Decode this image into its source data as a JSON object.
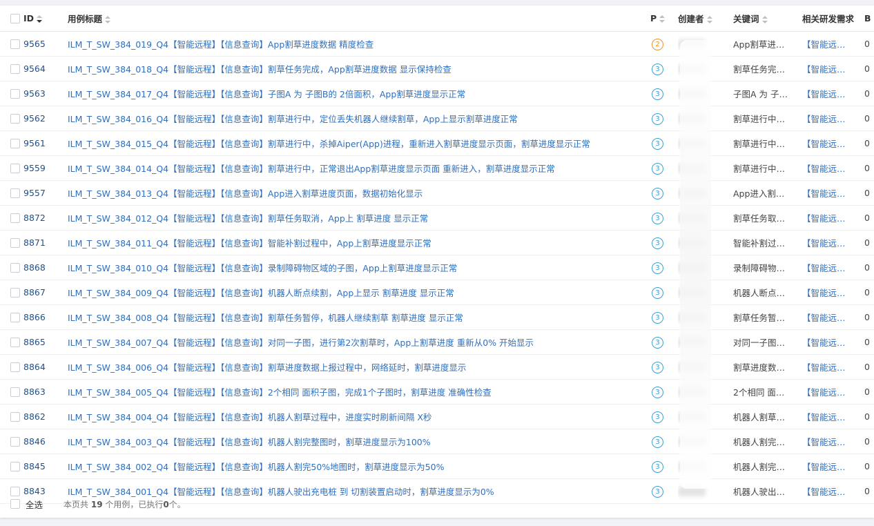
{
  "columns": {
    "id": "ID",
    "title": "用例标题",
    "priority": "P",
    "creator": "创建者",
    "keywords": "关键词",
    "requirement": "相关研发需求",
    "b": "B"
  },
  "rows": [
    {
      "id": "9565",
      "title": "ILM_T_SW_384_019_Q4【智能远程】【信息查询】App割草进度数据 精度检查",
      "priority": "2",
      "keywords": "App割草进…",
      "requirement": "【智能远…",
      "b": "0"
    },
    {
      "id": "9564",
      "title": "ILM_T_SW_384_018_Q4【智能远程】【信息查询】割草任务完成，App割草进度数据 显示保持检查",
      "priority": "3",
      "keywords": "割草任务完…",
      "requirement": "【智能远…",
      "b": "0"
    },
    {
      "id": "9563",
      "title": "ILM_T_SW_384_017_Q4【智能远程】【信息查询】子图A 为 子图B的 2倍面积，App割草进度显示正常",
      "priority": "3",
      "keywords": "子图A 为 子…",
      "requirement": "【智能远…",
      "b": "0"
    },
    {
      "id": "9562",
      "title": "ILM_T_SW_384_016_Q4【智能远程】【信息查询】割草进行中，定位丢失机器人继续割草，App上显示割草进度正常",
      "priority": "3",
      "keywords": "割草进行中…",
      "requirement": "【智能远…",
      "b": "0"
    },
    {
      "id": "9561",
      "title": "ILM_T_SW_384_015_Q4【智能远程】【信息查询】割草进行中，杀掉Aiper(App)进程，重新进入割草进度显示页面，割草进度显示正常",
      "priority": "3",
      "keywords": "割草进行中…",
      "requirement": "【智能远…",
      "b": "0"
    },
    {
      "id": "9559",
      "title": "ILM_T_SW_384_014_Q4【智能远程】【信息查询】割草进行中，正常退出App割草进度显示页面 重新进入，割草进度显示正常",
      "priority": "3",
      "keywords": "割草进行中…",
      "requirement": "【智能远…",
      "b": "0"
    },
    {
      "id": "9557",
      "title": "ILM_T_SW_384_013_Q4【智能远程】【信息查询】App进入割草进度页面，数据初始化显示",
      "priority": "3",
      "keywords": "App进入割…",
      "requirement": "【智能远…",
      "b": "0"
    },
    {
      "id": "8872",
      "title": "ILM_T_SW_384_012_Q4【智能远程】【信息查询】割草任务取消，App上 割草进度 显示正常",
      "priority": "3",
      "keywords": "割草任务取…",
      "requirement": "【智能远…",
      "b": "0"
    },
    {
      "id": "8871",
      "title": "ILM_T_SW_384_011_Q4【智能远程】【信息查询】智能补割过程中，App上割草进度显示正常",
      "priority": "3",
      "keywords": "智能补割过…",
      "requirement": "【智能远…",
      "b": "0"
    },
    {
      "id": "8868",
      "title": "ILM_T_SW_384_010_Q4【智能远程】【信息查询】录制障碍物区域的子图，App上割草进度显示正常",
      "priority": "3",
      "keywords": "录制障碍物…",
      "requirement": "【智能远…",
      "b": "0"
    },
    {
      "id": "8867",
      "title": "ILM_T_SW_384_009_Q4【智能远程】【信息查询】机器人断点续割，App上显示 割草进度 显示正常",
      "priority": "3",
      "keywords": "机器人断点…",
      "requirement": "【智能远…",
      "b": "0"
    },
    {
      "id": "8866",
      "title": "ILM_T_SW_384_008_Q4【智能远程】【信息查询】割草任务暂停，机器人继续割草 割草进度 显示正常",
      "priority": "3",
      "keywords": "割草任务暂…",
      "requirement": "【智能远…",
      "b": "0"
    },
    {
      "id": "8865",
      "title": "ILM_T_SW_384_007_Q4【智能远程】【信息查询】对同一子图，进行第2次割草时，App上割草进度 重新从0% 开始显示",
      "priority": "3",
      "keywords": "对同一子图…",
      "requirement": "【智能远…",
      "b": "0"
    },
    {
      "id": "8864",
      "title": "ILM_T_SW_384_006_Q4【智能远程】【信息查询】割草进度数据上报过程中，网络延时，割草进度显示",
      "priority": "3",
      "keywords": "割草进度数…",
      "requirement": "【智能远…",
      "b": "0"
    },
    {
      "id": "8863",
      "title": "ILM_T_SW_384_005_Q4【智能远程】【信息查询】2个相同 面积子图，完成1个子图时，割草进度 准确性检查",
      "priority": "3",
      "keywords": "2个相同 面…",
      "requirement": "【智能远…",
      "b": "0"
    },
    {
      "id": "8862",
      "title": "ILM_T_SW_384_004_Q4【智能远程】【信息查询】机器人割草过程中，进度实时刷新间隔 X秒",
      "priority": "3",
      "keywords": "机器人割草…",
      "requirement": "【智能远…",
      "b": "0"
    },
    {
      "id": "8846",
      "title": "ILM_T_SW_384_003_Q4【智能远程】【信息查询】机器人割完整图时，割草进度显示为100%",
      "priority": "3",
      "keywords": "机器人割完…",
      "requirement": "【智能远…",
      "b": "0"
    },
    {
      "id": "8845",
      "title": "ILM_T_SW_384_002_Q4【智能远程】【信息查询】机器人割完50%地图时，割草进度显示为50%",
      "priority": "3",
      "keywords": "机器人割完…",
      "requirement": "【智能远…",
      "b": "0"
    },
    {
      "id": "8843",
      "title": "ILM_T_SW_384_001_Q4【智能远程】【信息查询】机器人驶出充电桩 到 切割装置启动时，割草进度显示为0%",
      "priority": "3",
      "keywords": "机器人驶出…",
      "requirement": "【智能远…",
      "b": "0"
    }
  ],
  "footer": {
    "select_all": "全选",
    "summary_prefix": "本页共",
    "summary_count": "19",
    "summary_mid": "个用例，已执行",
    "summary_executed": "0",
    "summary_suffix": "个。"
  },
  "colors": {
    "link": "#2f6fbd",
    "id": "#1d4f91",
    "priority_2": "#f0902a",
    "priority_3": "#3aa0d6"
  }
}
